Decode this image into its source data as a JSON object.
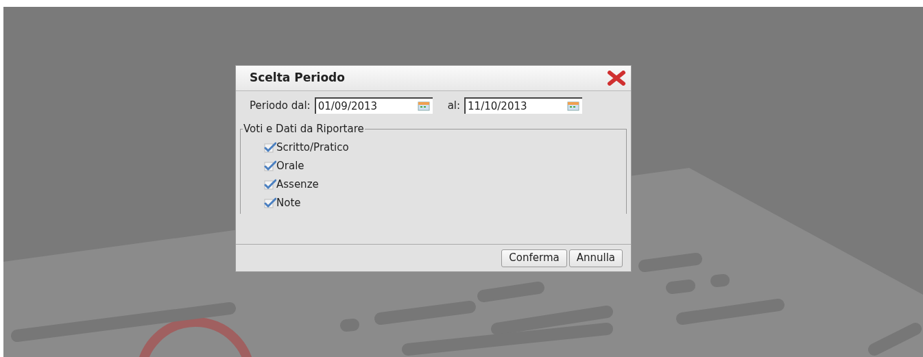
{
  "dialog": {
    "title": "Scelta Periodo",
    "period": {
      "from_label": "Periodo dal:",
      "from_value": "01/09/2013",
      "to_label": "al:",
      "to_value": "11/10/2013"
    },
    "group": {
      "title": "Voti e Dati da Riportare",
      "options": [
        {
          "label": "Scritto/Pratico",
          "checked": true
        },
        {
          "label": "Orale",
          "checked": true
        },
        {
          "label": "Assenze",
          "checked": true
        },
        {
          "label": "Note",
          "checked": true
        }
      ]
    },
    "buttons": [
      "Conferma",
      "Annulla"
    ]
  }
}
